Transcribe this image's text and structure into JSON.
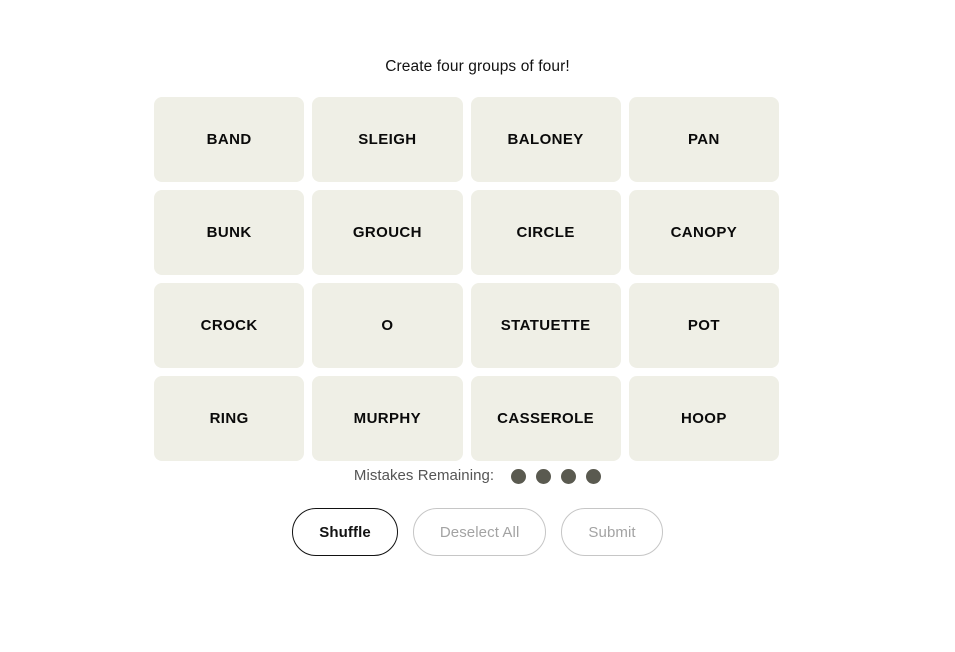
{
  "game": {
    "title": "Create four groups of four!",
    "grid": {
      "columns": 4,
      "rows": 4,
      "tiles": [
        {
          "label": "BAND"
        },
        {
          "label": "SLEIGH"
        },
        {
          "label": "BALONEY"
        },
        {
          "label": "PAN"
        },
        {
          "label": "BUNK"
        },
        {
          "label": "GROUCH"
        },
        {
          "label": "CIRCLE"
        },
        {
          "label": "CANOPY"
        },
        {
          "label": "CROCK"
        },
        {
          "label": "O"
        },
        {
          "label": "STATUETTE"
        },
        {
          "label": "POT"
        },
        {
          "label": "RING"
        },
        {
          "label": "MURPHY"
        },
        {
          "label": "CASSEROLE"
        },
        {
          "label": "HOOP"
        }
      ]
    },
    "mistakes": {
      "label": "Mistakes Remaining:",
      "remaining": 4,
      "dot_color": "#5a5a50"
    },
    "buttons": [
      {
        "label": "Shuffle",
        "state": "active"
      },
      {
        "label": "Deselect All",
        "state": "disabled"
      },
      {
        "label": "Submit",
        "state": "disabled"
      }
    ],
    "colors": {
      "page_background": "#ffffff",
      "tile_background": "#efefe6",
      "tile_text": "#0a0a0a",
      "title_text": "#121212",
      "mistakes_text": "#555555",
      "active_button_border": "#121212",
      "disabled_button_border": "#c6c6c6",
      "disabled_button_text": "#a3a3a3"
    }
  }
}
